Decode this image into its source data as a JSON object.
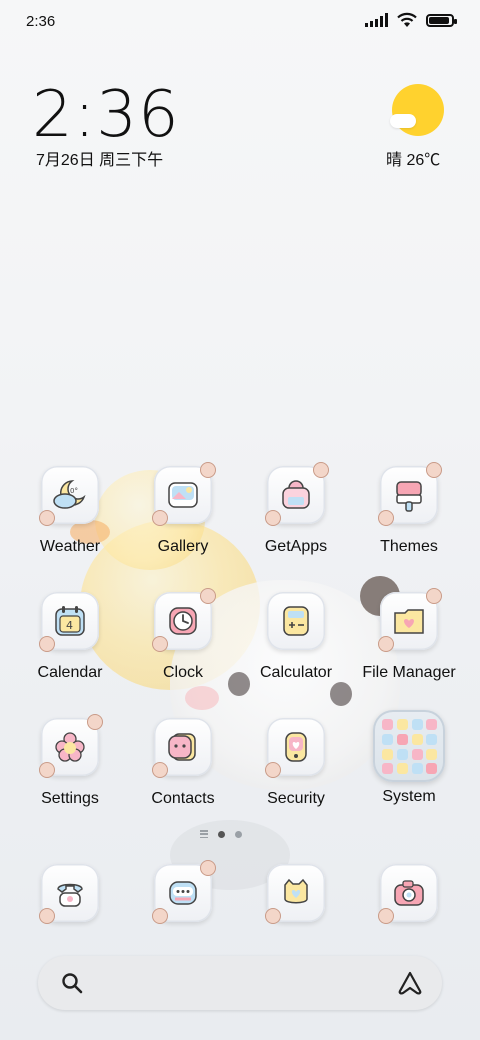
{
  "status_bar": {
    "time": "2:36",
    "icons": [
      "signal-icon",
      "wifi-icon",
      "battery-icon"
    ],
    "battery_level": 0.9
  },
  "clock_widget": {
    "time": "2:36",
    "date": "7月26日 周三下午"
  },
  "weather_widget": {
    "icon": "sun-cloud-icon",
    "text": "晴 26℃"
  },
  "apps": {
    "weather": {
      "label": "Weather",
      "icon": "weather-moon-cloud-icon"
    },
    "gallery": {
      "label": "Gallery",
      "icon": "gallery-picture-icon"
    },
    "getapps": {
      "label": "GetApps",
      "icon": "shopping-bag-icon"
    },
    "themes": {
      "label": "Themes",
      "icon": "paint-brush-icon"
    },
    "calendar": {
      "label": "Calendar",
      "icon": "calendar-icon",
      "day": "4"
    },
    "clock": {
      "label": "Clock",
      "icon": "clock-icon"
    },
    "calculator": {
      "label": "Calculator",
      "icon": "calculator-icon"
    },
    "file_manager": {
      "label": "File Manager",
      "icon": "folder-heart-icon"
    },
    "settings": {
      "label": "Settings",
      "icon": "flower-gear-icon"
    },
    "contacts": {
      "label": "Contacts",
      "icon": "contact-book-icon"
    },
    "security": {
      "label": "Security",
      "icon": "shield-phone-icon"
    },
    "system": {
      "label": "System",
      "icon": "app-folder-icon"
    }
  },
  "dock": [
    {
      "name": "phone",
      "icon": "telephone-icon"
    },
    {
      "name": "messages",
      "icon": "message-bubble-icon"
    },
    {
      "name": "browser",
      "icon": "cat-face-icon"
    },
    {
      "name": "camera",
      "icon": "camera-icon"
    }
  ],
  "page_indicator": {
    "pages": 2,
    "current": 1
  },
  "search_bar": {
    "icon": "search-icon",
    "assistant_icon": "assistant-icon"
  },
  "colors": {
    "accent_yellow": "#ffd22e",
    "icon_pink": "#f7b6c7",
    "icon_blue": "#bfe0f5",
    "icon_yellow": "#fbe7a1"
  }
}
